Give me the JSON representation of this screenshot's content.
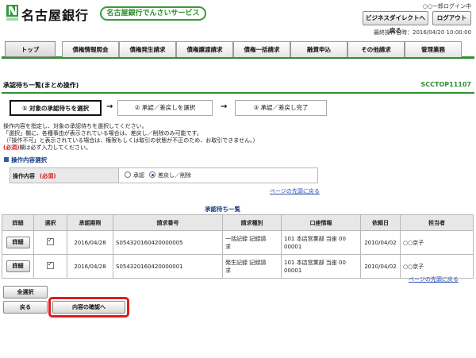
{
  "header": {
    "bank_name": "名古屋銀行",
    "service_name": "名古屋銀行でんさいサービス",
    "user_login": "○○一郎ログイン中",
    "back_button": "ビジネスダイレクトへ戻る",
    "logout_button": "ログアウト",
    "last_operation": "最終操作日時：2016/04/20 10:00:00",
    "brand_color": "#2f8f2f"
  },
  "nav": {
    "top": "トップ",
    "tabs": [
      "債権情報照会",
      "債権発生請求",
      "債権譲渡請求",
      "債権一括請求",
      "融資申込",
      "その他請求",
      "管理業務"
    ]
  },
  "page": {
    "title": "承認待ち一覧(まとめ操作)",
    "screen_id": "SCCTOP11107"
  },
  "steps": [
    "① 対象の承認待ちを選択",
    "② 承認／差戻しを選択",
    "③ 承認／差戻し完了"
  ],
  "instructions": {
    "line1": "操作内容を指定し、対象の承認待ちを選択してください。",
    "line2": "「選択」欄に、各種事由が表示されている場合は、差戻し／削除のみ可能です。",
    "line3": "（「操作不可」と表示されている場合は、権限もしくは取引の状態が不正のため、お取引できません。）",
    "line4_req": "(必須)",
    "line4": "欄は必ず入力してください。"
  },
  "operation": {
    "section_title": "操作内容選択",
    "label": "操作内容",
    "required": "(必須)",
    "option_approve": "承認",
    "option_reject": "差戻し／削除",
    "selected": "差戻し／削除",
    "page_top_link": "ページの先頭に戻る"
  },
  "list": {
    "title": "承認待ち一覧",
    "columns": [
      "詳細",
      "選択",
      "承認期限",
      "請求番号",
      "請求種別",
      "口座情報",
      "依頼日",
      "担当者"
    ],
    "rows": [
      {
        "detail": "詳細",
        "selected": true,
        "deadline": "2016/04/28",
        "request_no": "S054320160420000005",
        "type_line1": "一括記録 記録請",
        "type_line2": "求",
        "account_line1": "101 本店営業部 当座 00",
        "account_line2": "00001",
        "request_date": "2010/04/02",
        "staff": "○○京子"
      },
      {
        "detail": "詳細",
        "selected": true,
        "deadline": "2016/04/28",
        "request_no": "S054320160420000001",
        "type_line1": "発生記録 記録請",
        "type_line2": "求",
        "account_line1": "101 本店営業部 当座 00",
        "account_line2": "00001",
        "request_date": "2010/04/02",
        "staff": "○○京子"
      }
    ],
    "page_top_link": "ページの先頭に戻る"
  },
  "buttons": {
    "select_all": "全選択",
    "back": "戻る",
    "confirm": "内容の確認へ",
    "highlight_color": "#e31b1b"
  }
}
